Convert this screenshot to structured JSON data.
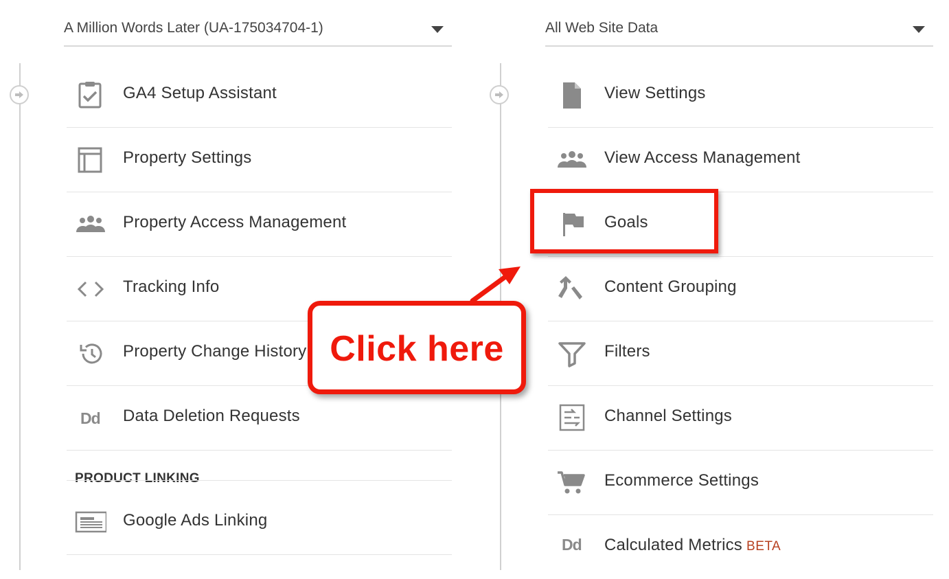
{
  "left": {
    "selector": {
      "label": "A Million Words Later (UA-175034704-1)"
    },
    "items": [
      {
        "label": "GA4 Setup Assistant",
        "icon": "clipboard-check-icon"
      },
      {
        "label": "Property Settings",
        "icon": "layout-icon"
      },
      {
        "label": "Property Access Management",
        "icon": "people-icon"
      },
      {
        "label": "Tracking Info",
        "icon": "code-brackets-icon"
      },
      {
        "label": "Property Change History",
        "icon": "history-icon"
      },
      {
        "label": "Data Deletion Requests",
        "icon": "dd-icon",
        "icon_text": "Dd"
      }
    ],
    "section_heading": "PRODUCT LINKING",
    "linking_items": [
      {
        "label": "Google Ads Linking",
        "icon": "ads-linking-icon"
      }
    ]
  },
  "right": {
    "selector": {
      "label": "All Web Site Data"
    },
    "items": [
      {
        "label": "View Settings",
        "icon": "document-icon"
      },
      {
        "label": "View Access Management",
        "icon": "people-icon"
      },
      {
        "label": "Goals",
        "icon": "flag-icon"
      },
      {
        "label": "Content Grouping",
        "icon": "content-grouping-icon"
      },
      {
        "label": "Filters",
        "icon": "filter-icon"
      },
      {
        "label": "Channel Settings",
        "icon": "channel-settings-icon"
      },
      {
        "label": "Ecommerce Settings",
        "icon": "cart-icon"
      },
      {
        "label": "Calculated Metrics",
        "icon": "dd-icon",
        "icon_text": "Dd",
        "badge": "BETA"
      }
    ]
  },
  "annotation": {
    "callout_text": "Click here",
    "color": "#ef1a0c"
  },
  "colors": {
    "icon_gray": "#8a8a8a",
    "text": "#333333",
    "beta": "#b7401f",
    "divider": "#e4e4e4"
  }
}
